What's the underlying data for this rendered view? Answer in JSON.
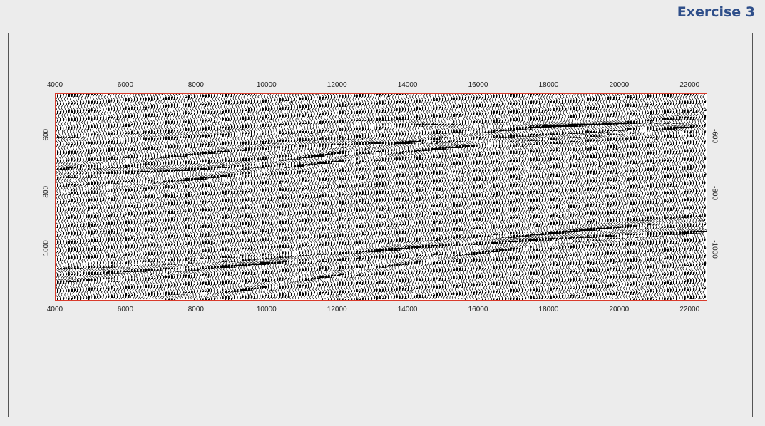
{
  "title": "Exercise 3",
  "section": {
    "x_ticks": [
      "4000",
      "6000",
      "8000",
      "10000",
      "12000",
      "14000",
      "16000",
      "18000",
      "20000",
      "22000"
    ],
    "y_ticks_left": [
      "-600",
      "-800",
      "-1000"
    ],
    "y_ticks_right": [
      "-600",
      "-800",
      "-1000"
    ],
    "x_range": [
      4000,
      22500
    ],
    "y_range": [
      -450,
      -1180
    ],
    "colors": {
      "wiggle": "#000000",
      "border": "#d93a2b",
      "background": "#ffffff",
      "title": "#2f4f8a"
    }
  }
}
